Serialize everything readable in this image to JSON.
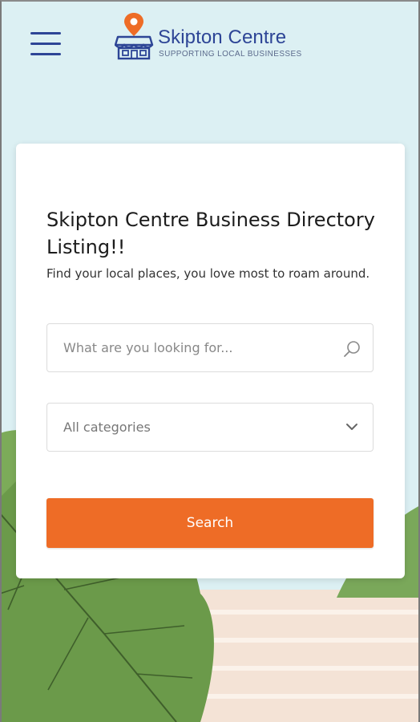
{
  "colors": {
    "brand_blue": "#2d4596",
    "brand_orange": "#ee6c26",
    "sky": "#dcf0f3",
    "foliage": "#6b9a4a",
    "ground": "#f4e3d6"
  },
  "header": {
    "menu_icon": "hamburger-menu-icon",
    "logo": {
      "icon": "shop-with-location-pin-icon",
      "title": "Skipton Centre",
      "tagline": "SUPPORTING LOCAL BUSINESSES"
    }
  },
  "search_card": {
    "title": "Skipton Centre Business Directory Listing!!",
    "subtitle": "Find your local places, you love most to roam around.",
    "search_input": {
      "placeholder": "What are you looking for...",
      "value": "",
      "icon": "search-icon"
    },
    "category_select": {
      "selected": "All categories",
      "icon": "chevron-down-icon"
    },
    "search_button_label": "Search"
  }
}
